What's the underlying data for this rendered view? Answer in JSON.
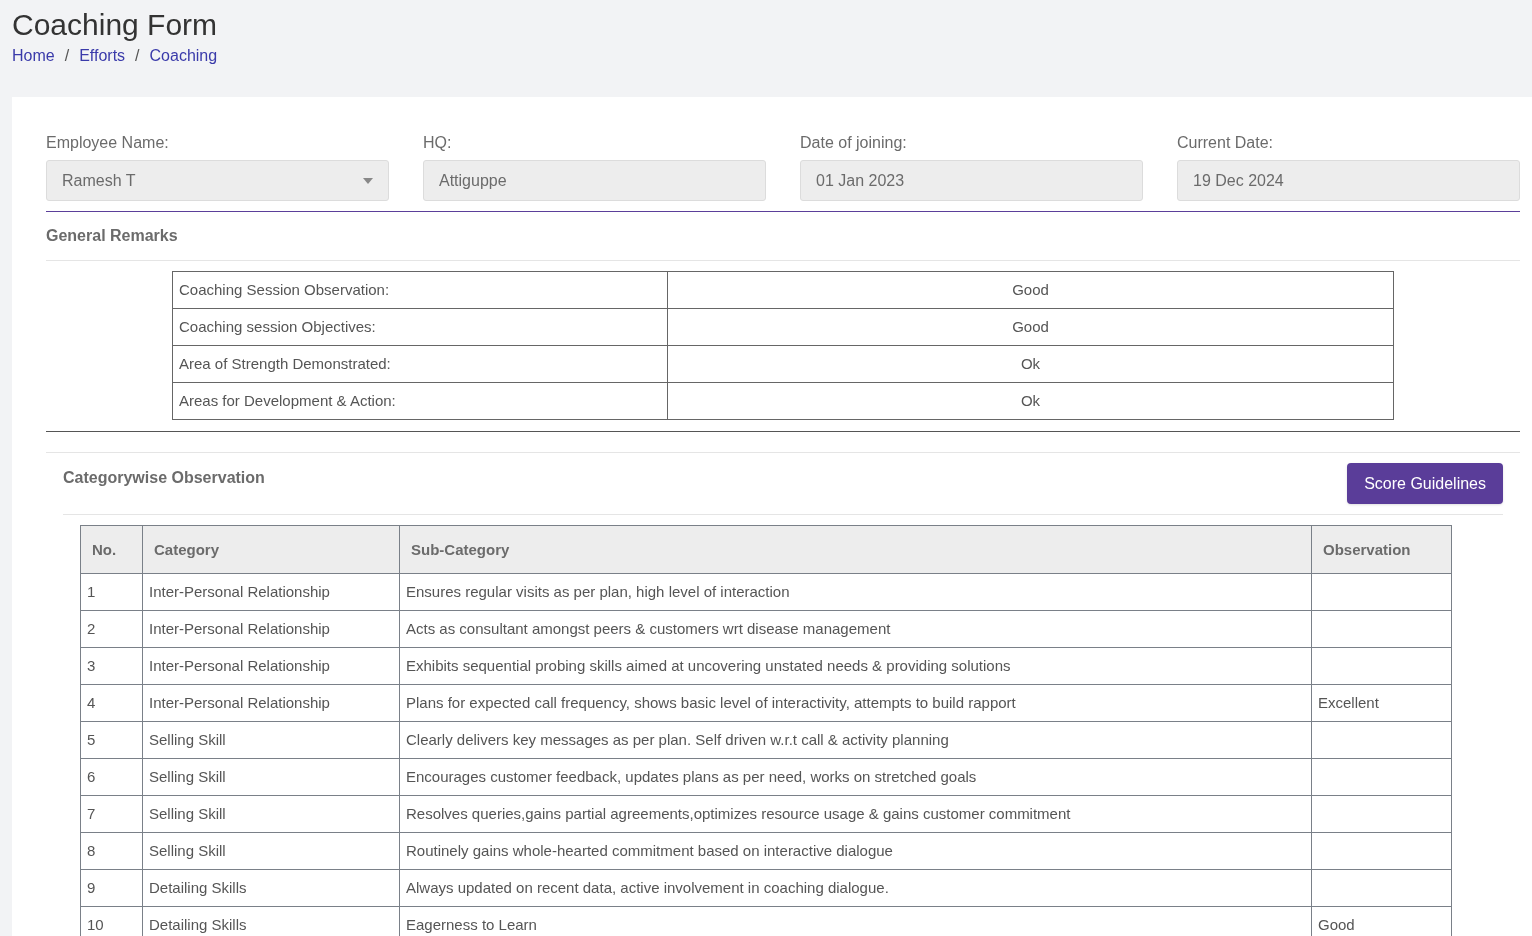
{
  "page_title": "Coaching Form",
  "breadcrumbs": [
    "Home",
    "Efforts",
    "Coaching"
  ],
  "breadcrumb_separators": [
    "/",
    "/"
  ],
  "fields": [
    {
      "label": "Employee Name:",
      "value": "Ramesh T",
      "kind": "select"
    },
    {
      "label": "HQ:",
      "value": "Attiguppe",
      "kind": "text"
    },
    {
      "label": "Date of joining:",
      "value": "01 Jan 2023",
      "kind": "text"
    },
    {
      "label": "Current Date:",
      "value": "19 Dec 2024",
      "kind": "text"
    }
  ],
  "general_remarks": {
    "title": "General Remarks",
    "rows": [
      {
        "label": "Coaching Session Observation:",
        "value": "Good"
      },
      {
        "label": "Coaching session Objectives:",
        "value": "Good"
      },
      {
        "label": "Area of Strength Demonstrated:",
        "value": "Ok"
      },
      {
        "label": "Areas for Development & Action:",
        "value": "Ok"
      }
    ]
  },
  "categorywise": {
    "title": "Categorywise Observation",
    "button": "Score Guidelines",
    "columns": [
      "No.",
      "Category",
      "Sub-Category",
      "Observation"
    ],
    "rows": [
      {
        "no": "1",
        "category": "Inter-Personal Relationship",
        "sub_category": "Ensures regular visits as per plan, high level of interaction"
      },
      {
        "no": "2",
        "category": "Inter-Personal Relationship",
        "sub_category": "Acts as consultant amongst peers & customers wrt disease management"
      },
      {
        "no": "3",
        "category": "Inter-Personal Relationship",
        "sub_category": "Exhibits sequential probing skills aimed at uncovering unstated needs & providing solutions"
      },
      {
        "no": "4",
        "category": "Inter-Personal Relationship",
        "sub_category": "Plans for expected call frequency, shows basic level of interactivity, attempts to build rapport",
        "observation": "Excellent"
      },
      {
        "no": "5",
        "category": "Selling Skill",
        "sub_category": "Clearly delivers key messages as per plan. Self driven w.r.t call & activity planning"
      },
      {
        "no": "6",
        "category": "Selling Skill",
        "sub_category": "Encourages customer feedback, updates plans as per need, works on stretched goals"
      },
      {
        "no": "7",
        "category": "Selling Skill",
        "sub_category": "Resolves queries,gains partial agreements,optimizes resource usage & gains customer commitment"
      },
      {
        "no": "8",
        "category": "Selling Skill",
        "sub_category": "Routinely gains whole-hearted commitment based on interactive dialogue"
      },
      {
        "no": "9",
        "category": "Detailing Skills",
        "sub_category": "Always updated on recent data, active involvement in coaching dialogue."
      },
      {
        "no": "10",
        "category": "Detailing Skills",
        "sub_category": "Eagerness to Learn",
        "observation": "Good"
      }
    ]
  }
}
